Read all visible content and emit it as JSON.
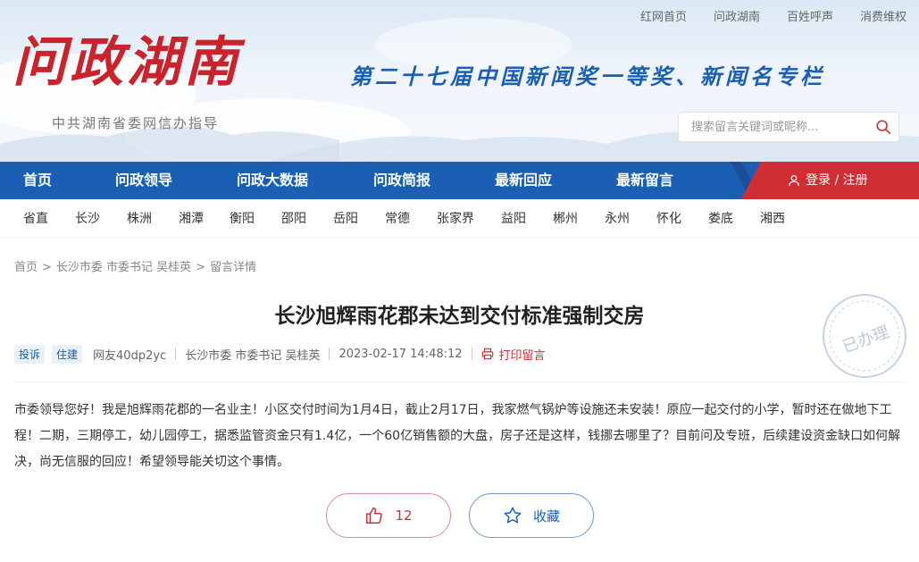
{
  "top_links": [
    "红网首页",
    "问政湖南",
    "百姓呼声",
    "消费维权"
  ],
  "logo": {
    "title": "问政湖南",
    "subtitle": "中共湖南省委网信办指导"
  },
  "slogan": "第二十七届中国新闻奖一等奖、新闻名专栏",
  "search": {
    "placeholder": "搜索留言关键词或昵称..."
  },
  "nav": {
    "items": [
      "首页",
      "问政领导",
      "问政大数据",
      "问政简报",
      "最新回应",
      "最新留言"
    ],
    "login_label": "登录 / 注册"
  },
  "regions": [
    "省直",
    "长沙",
    "株洲",
    "湘潭",
    "衡阳",
    "邵阳",
    "岳阳",
    "常德",
    "张家界",
    "益阳",
    "郴州",
    "永州",
    "怀化",
    "娄底",
    "湘西"
  ],
  "breadcrumb": {
    "home": "首页",
    "sep": ">",
    "leader": "长沙市委 市委书记 吴桂英",
    "current": "留言详情"
  },
  "post": {
    "title": "长沙旭辉雨花郡未达到交付标准强制交房",
    "tags": [
      "投诉",
      "住建"
    ],
    "author": "网友40dp2yc",
    "target": "长沙市委 市委书记 吴桂英",
    "time": "2023-02-17 14:48:12",
    "print_label": "打印留言",
    "stamp": "已办理",
    "body": "市委领导您好！我是旭辉雨花郡的一名业主！小区交付时间为1月4日，截止2月17日，我家燃气锅炉等设施还未安装！原应一起交付的小学，暂时还在做地下工程！二期，三期停工，幼儿园停工，据悉监管资金只有1.4亿，一个60亿销售额的大盘，房子还是这样，钱挪去哪里了？目前问及专班，后续建设资金缺口如何解决，尚无信服的回应！希望领导能关切这个事情。"
  },
  "actions": {
    "like_count": "12",
    "favorite_label": "收藏"
  },
  "colors": {
    "brand_blue": "#1a5fb4",
    "brand_red": "#cf2e34"
  }
}
